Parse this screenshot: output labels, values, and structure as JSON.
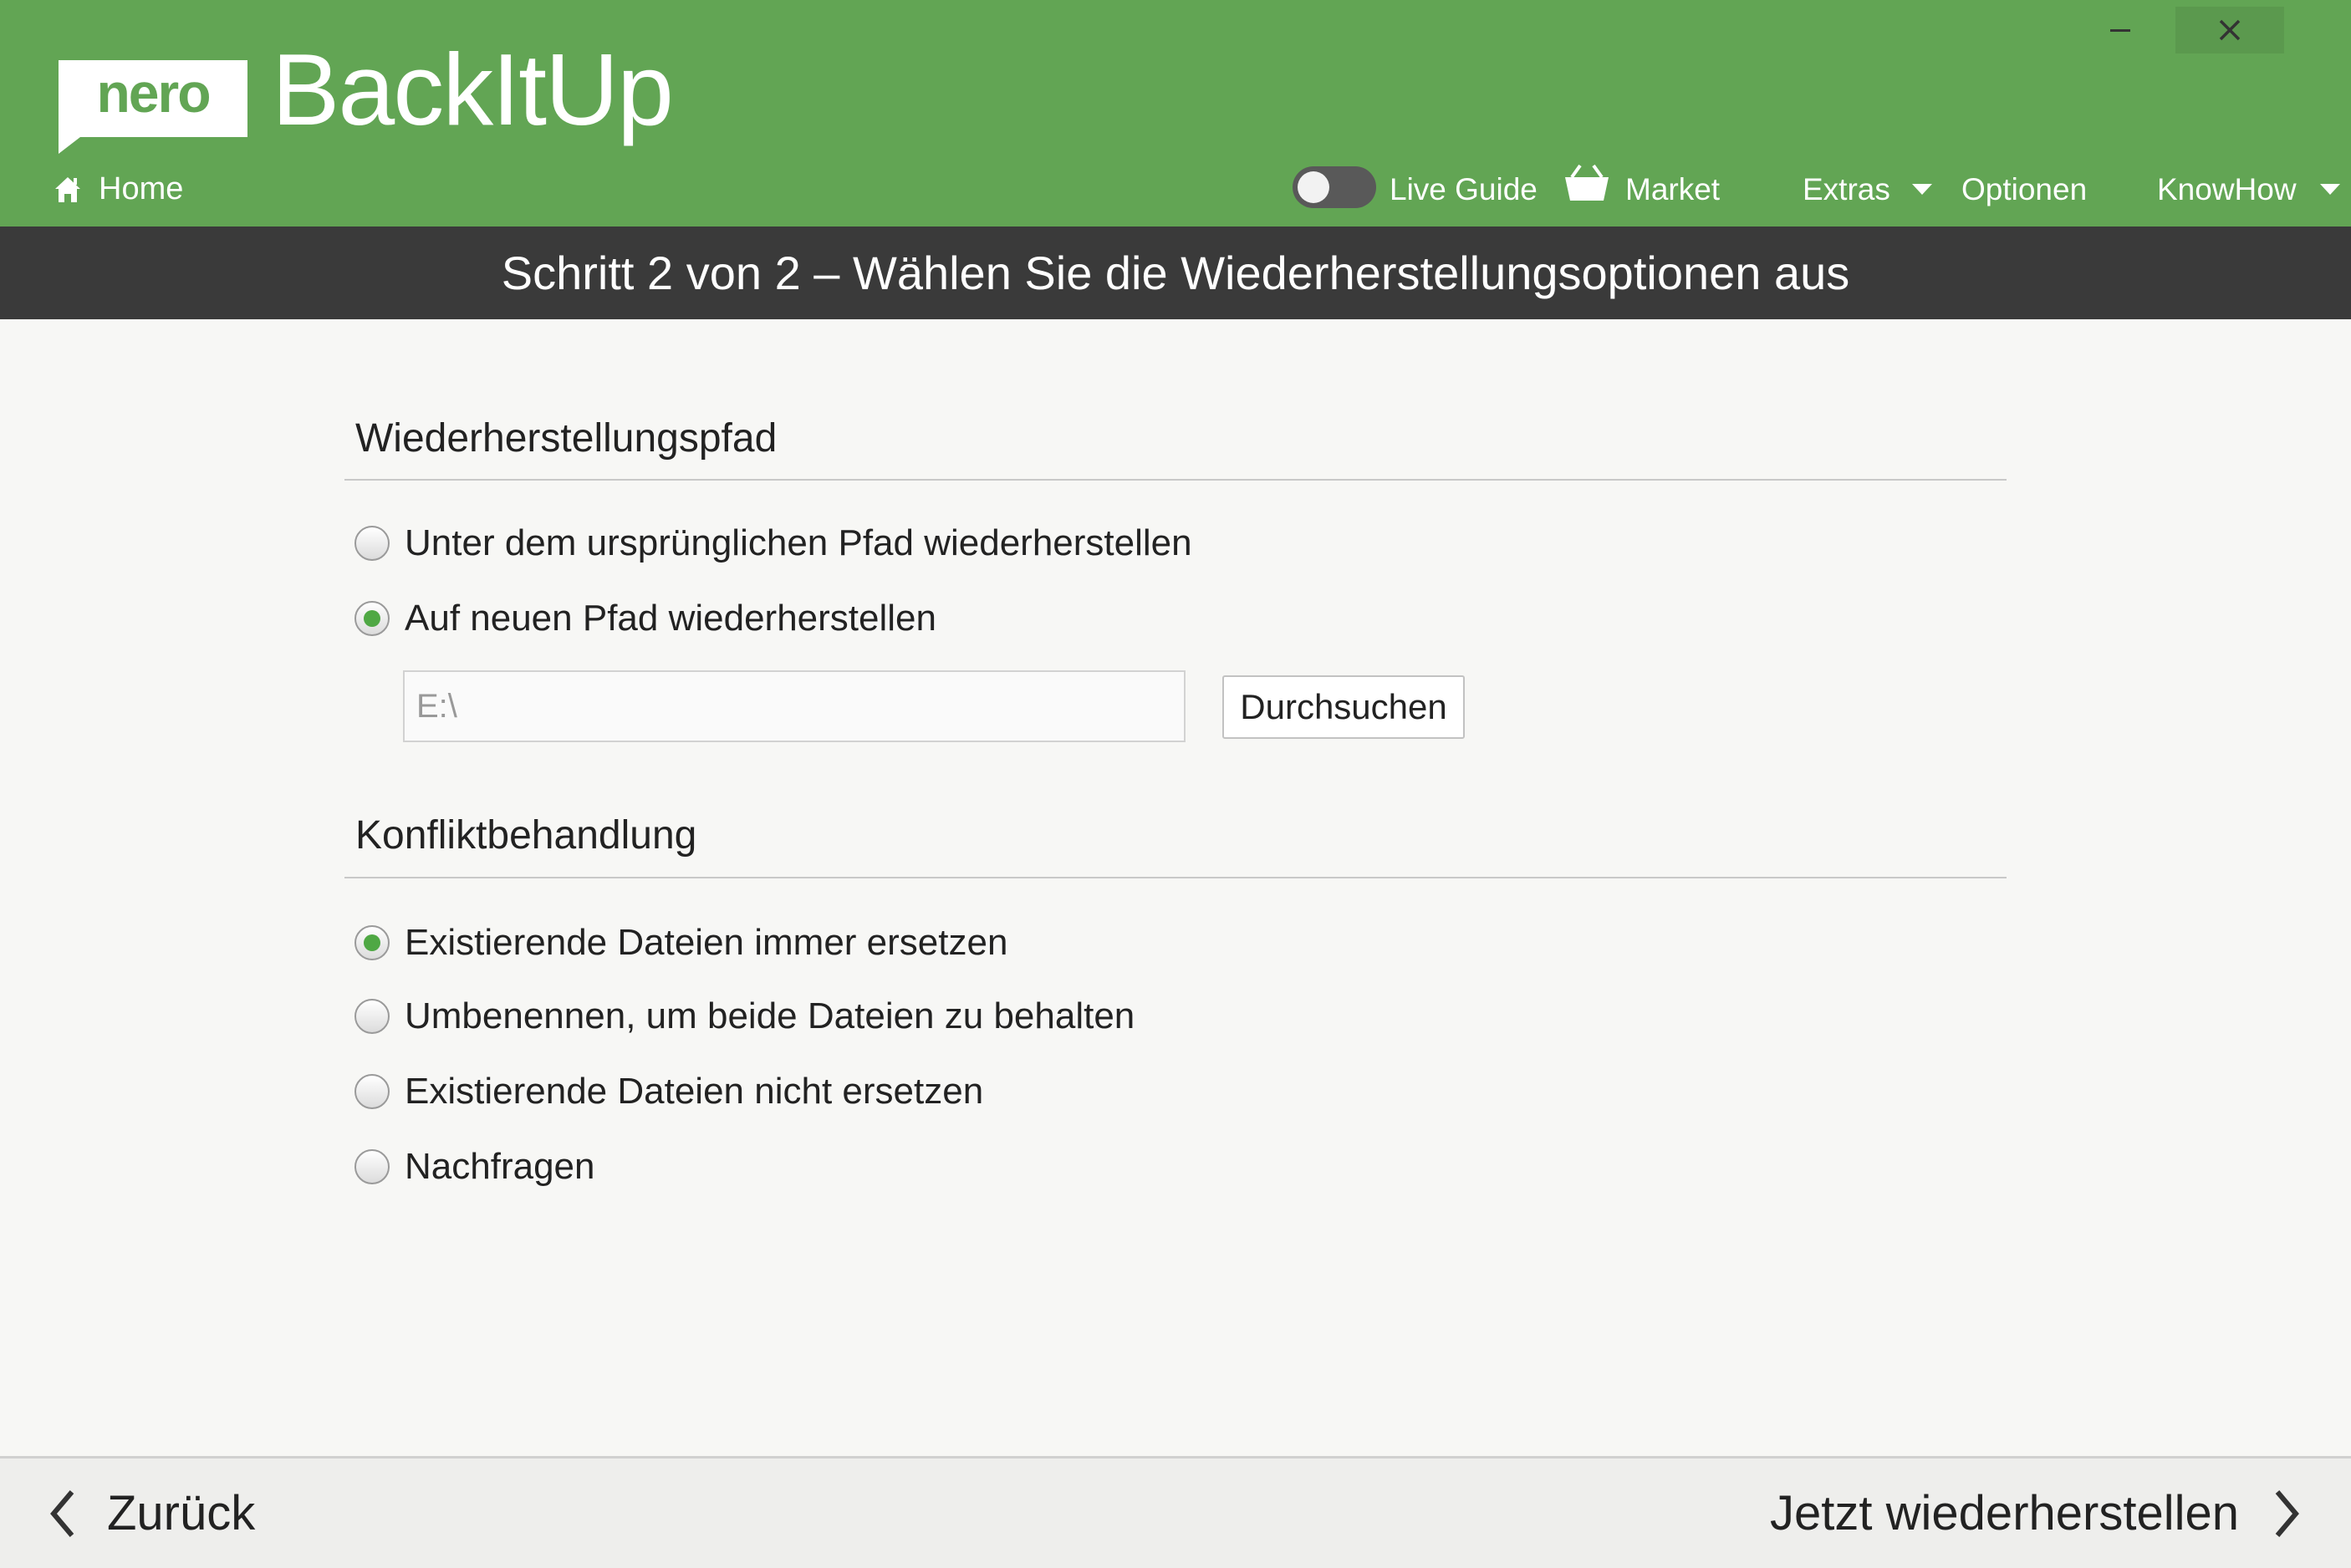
{
  "header": {
    "logo_text": "nero",
    "app_name": "BackItUp",
    "home_label": "Home",
    "live_guide_label": "Live Guide",
    "live_guide_enabled": false,
    "market_label": "Market",
    "extras_label": "Extras",
    "options_label": "Optionen",
    "knowhow_label": "KnowHow",
    "brand_color": "#62a554"
  },
  "stepbar": {
    "title": "Schritt 2 von 2 – Wählen Sie die Wiederherstellungsoptionen aus"
  },
  "restore_path": {
    "title": "Wiederherstellungspfad",
    "options": [
      {
        "label": "Unter dem ursprünglichen Pfad wiederherstellen",
        "selected": false
      },
      {
        "label": "Auf neuen Pfad wiederherstellen",
        "selected": true
      }
    ],
    "path_value": "E:\\",
    "browse_label": "Durchsuchen"
  },
  "conflict": {
    "title": "Konfliktbehandlung",
    "options": [
      {
        "label": "Existierende Dateien immer ersetzen",
        "selected": true
      },
      {
        "label": "Umbenennen, um beide Dateien zu behalten",
        "selected": false
      },
      {
        "label": "Existierende Dateien nicht ersetzen",
        "selected": false
      },
      {
        "label": "Nachfragen",
        "selected": false
      }
    ]
  },
  "footer": {
    "back_label": "Zurück",
    "next_label": "Jetzt wiederherstellen"
  }
}
